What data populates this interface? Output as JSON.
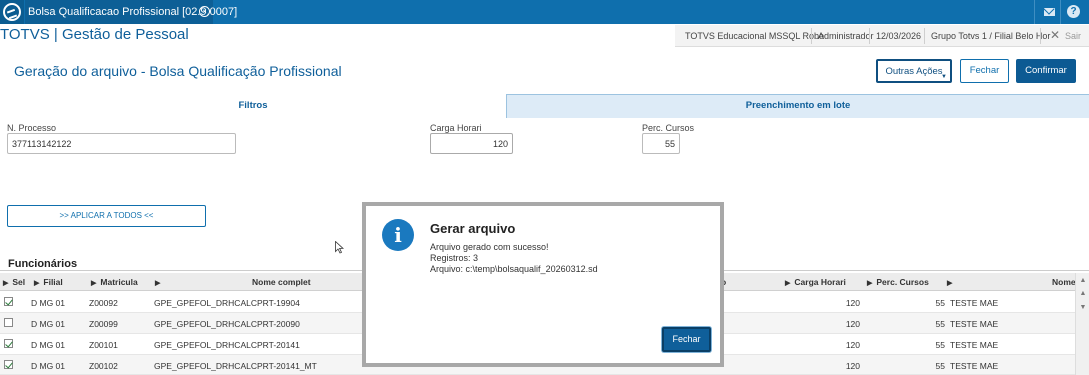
{
  "window": {
    "tab_title": "Bolsa Qualificacao Profissional [02.9.0007]",
    "close_glyph": "×"
  },
  "app": {
    "title": "TOTVS | Gestão de Pessoal"
  },
  "infobar": {
    "environment": "TOTVS Educacional MSSQL Robo",
    "user": "Administrador",
    "date": "12/03/2026",
    "group": "Grupo Totvs 1 / Filial Belo Hor",
    "exit_label": "Sair"
  },
  "page": {
    "title": "Geração do arquivo - Bolsa Qualificação Profissional"
  },
  "toolbar": {
    "outras_acoes": "Outras Ações",
    "fechar": "Fechar",
    "confirmar": "Confirmar"
  },
  "tabs": {
    "filtros": "Filtros",
    "preenchimento": "Preenchimento em lote"
  },
  "form": {
    "processo_label": "N. Processo",
    "processo_value": "377113142122",
    "carga_label": "Carga Horari",
    "carga_value": "120",
    "perc_label": "Perc. Cursos",
    "perc_value": "55",
    "apply_button": ">> APLICAR A TODOS <<"
  },
  "grid": {
    "title": "Funcionários",
    "headers": {
      "sel": "Sel",
      "filial": "Filial",
      "matricula": "Matricula",
      "nome": "Nome complet",
      "col_o": "o",
      "carga": "Carga Horari",
      "perc": "Perc. Cursos",
      "nome2": "Nome"
    },
    "rows": [
      {
        "checked": true,
        "filial": "D MG 01",
        "matricula": "Z00092",
        "nome": "GPE_GPEFOL_DRHCALCPRT-19904",
        "carga": "120",
        "perc": "55",
        "nome2": "TESTE MAE"
      },
      {
        "checked": false,
        "filial": "D MG 01",
        "matricula": "Z00099",
        "nome": "GPE_GPEFOL_DRHCALCPRT-20090",
        "carga": "120",
        "perc": "55",
        "nome2": "TESTE MAE"
      },
      {
        "checked": true,
        "filial": "D MG 01",
        "matricula": "Z00101",
        "nome": "GPE_GPEFOL_DRHCALCPRT-20141",
        "carga": "120",
        "perc": "55",
        "nome2": "TESTE MAE"
      },
      {
        "checked": true,
        "filial": "D MG 01",
        "matricula": "Z00102",
        "nome": "GPE_GPEFOL_DRHCALCPRT-20141_MT",
        "carga": "120",
        "perc": "55",
        "nome2": "TESTE MAE"
      }
    ]
  },
  "dialog": {
    "icon": "info-icon",
    "title": "Gerar arquivo",
    "line1": "Arquivo gerado com sucesso!",
    "line2": "Registros: 3",
    "line3": "Arquivo: c:\\temp\\bolsaqualif_20260312.sd",
    "button": "Fechar"
  },
  "colors": {
    "brand_blue": "#0f6fad",
    "dark_blue": "#0c5a93",
    "tab_active_bg": "#ddebf7"
  }
}
